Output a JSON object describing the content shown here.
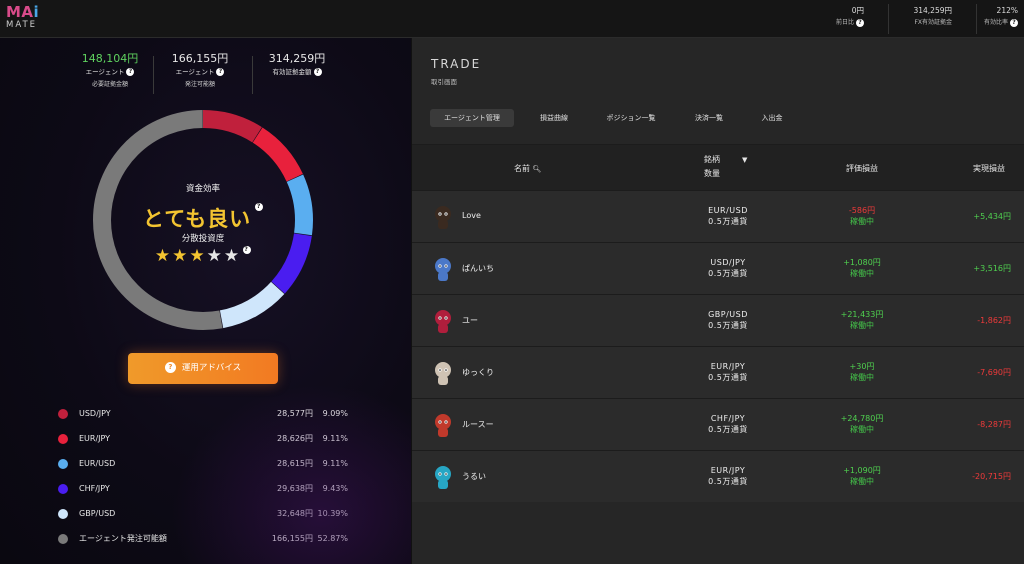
{
  "header": {
    "logo_main": [
      "MA",
      "i"
    ],
    "logo_sub": "MATE",
    "stats": [
      {
        "value": "0円",
        "label": "前日比"
      },
      {
        "value": "314,259円",
        "label": "FX有効証拠金"
      },
      {
        "value": "212%",
        "label": "有効比率"
      }
    ]
  },
  "summary": [
    {
      "amount": "148,104円",
      "label1": "エージェント",
      "label2": "必要証拠金額",
      "color": "#5fd35f"
    },
    {
      "amount": "166,155円",
      "label1": "エージェント",
      "label2": "発注可能額",
      "color": "#e8e8e8"
    },
    {
      "amount": "314,259円",
      "label1": "有効証拠金額",
      "label2": "",
      "color": "#e8e8e8"
    }
  ],
  "efficiency": {
    "label": "資金効率",
    "rating": "とても良い",
    "diversity_label": "分散投資度",
    "stars_filled": 3,
    "stars_total": 5,
    "stars_on": "★★★",
    "stars_off": "★★"
  },
  "advice_button": "運用アドバイス",
  "allocation": [
    {
      "name": "USD/JPY",
      "amount": "28,577円",
      "pct": "9.09%",
      "share": 9.09,
      "color": "#c0203c"
    },
    {
      "name": "EUR/JPY",
      "amount": "28,626円",
      "pct": "9.11%",
      "share": 9.11,
      "color": "#e8213c"
    },
    {
      "name": "EUR/USD",
      "amount": "28,615円",
      "pct": "9.11%",
      "share": 9.11,
      "color": "#5aaef0"
    },
    {
      "name": "CHF/JPY",
      "amount": "29,638円",
      "pct": "9.43%",
      "share": 9.43,
      "color": "#4a1df0"
    },
    {
      "name": "GBP/USD",
      "amount": "32,648円",
      "pct": "10.39%",
      "share": 10.39,
      "color": "#cfe6fb"
    },
    {
      "name": "エージェント発注可能額",
      "amount": "166,155円",
      "pct": "52.87%",
      "share": 52.87,
      "color": "#7a7a7a"
    }
  ],
  "trade": {
    "title": "TRADE",
    "subtitle": "取引画面",
    "tabs": [
      "エージェント管理",
      "損益曲線",
      "ポジション一覧",
      "決済一覧",
      "入出金"
    ],
    "active_tab": 0,
    "columns": {
      "name": "名前",
      "symbol": "銘柄",
      "quantity": "数量",
      "eval": "評価損益",
      "realized": "実現損益"
    },
    "rows": [
      {
        "name": "Love",
        "symbol": "EUR/USD",
        "qty": "0.5万通貨",
        "eval": "-586円",
        "eval_sign": "neg",
        "status": "稼働中",
        "realized": "+5,434円",
        "real_sign": "pos",
        "avatar": "bear-avatar",
        "color": "#3a2a20"
      },
      {
        "name": "ぱんいち",
        "symbol": "USD/JPY",
        "qty": "0.5万通貨",
        "eval": "+1,080円",
        "eval_sign": "pos",
        "status": "稼働中",
        "realized": "+3,516円",
        "real_sign": "pos",
        "avatar": "mushroom-avatar",
        "color": "#4b78c8"
      },
      {
        "name": "ユー",
        "symbol": "GBP/USD",
        "qty": "0.5万通貨",
        "eval": "+21,433円",
        "eval_sign": "pos",
        "status": "稼働中",
        "realized": "-1,862円",
        "real_sign": "neg",
        "avatar": "bird-avatar",
        "color": "#b01e3c"
      },
      {
        "name": "ゆっくり",
        "symbol": "EUR/JPY",
        "qty": "0.5万通貨",
        "eval": "+30円",
        "eval_sign": "pos",
        "status": "稼働中",
        "realized": "-7,690円",
        "real_sign": "neg",
        "avatar": "rabbit-avatar",
        "color": "#cfc3b4"
      },
      {
        "name": "ルースー",
        "symbol": "CHF/JPY",
        "qty": "0.5万通貨",
        "eval": "+24,780円",
        "eval_sign": "pos",
        "status": "稼働中",
        "realized": "-8,287円",
        "real_sign": "neg",
        "avatar": "squirrel-avatar",
        "color": "#c0392b"
      },
      {
        "name": "うるい",
        "symbol": "EUR/JPY",
        "qty": "0.5万通貨",
        "eval": "+1,090円",
        "eval_sign": "pos",
        "status": "稼働中",
        "realized": "-20,715円",
        "real_sign": "neg",
        "avatar": "dragon-avatar",
        "color": "#27a6c4"
      }
    ]
  }
}
